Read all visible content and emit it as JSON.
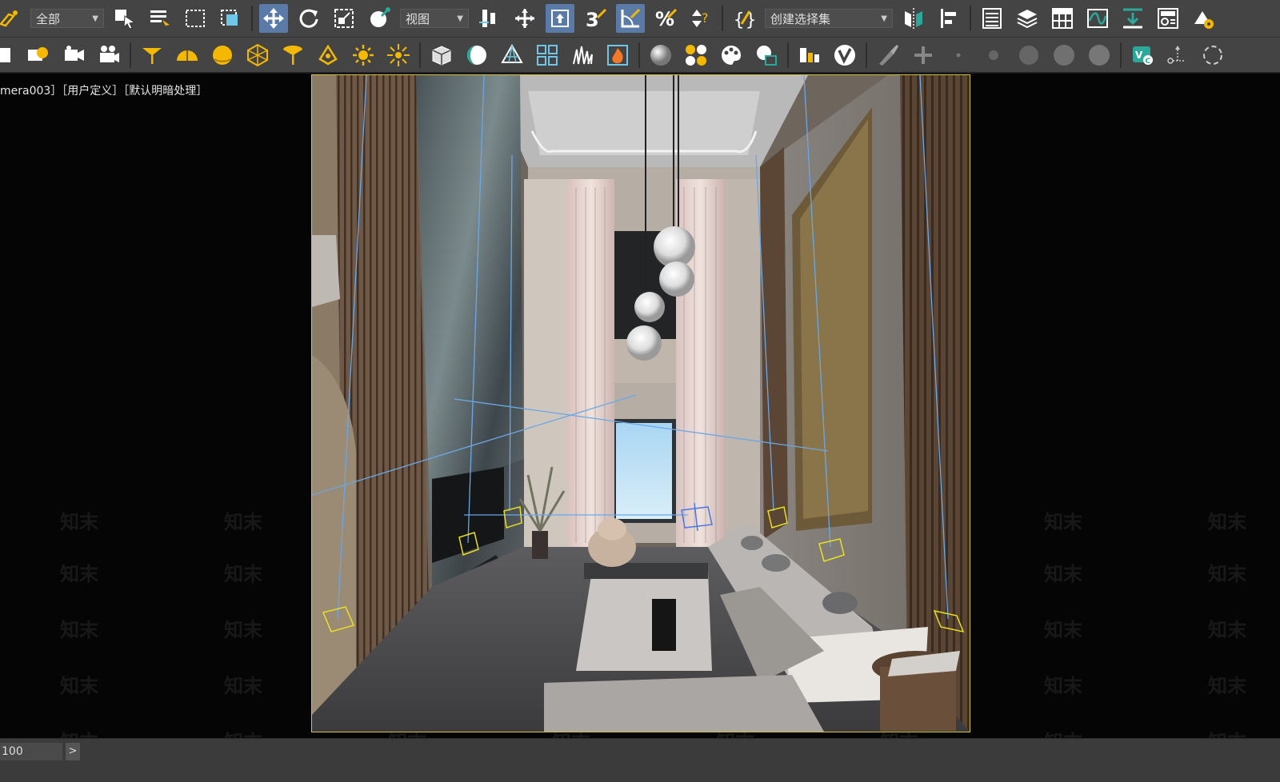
{
  "toolbar": {
    "selection_filter": "全部",
    "ref_coord_system": "视图",
    "named_selection_set": "创建选择集"
  },
  "viewport": {
    "label": "mera003］［用户定义］［默认明暗处理］",
    "watermark_text": "知末"
  },
  "timeline": {
    "frame_value": "100",
    "next_label": ">"
  },
  "colors": {
    "toolbar_bg": "#444444",
    "active_button": "#5a7aa8",
    "accent_yellow": "#f5b800",
    "safe_frame_border": "#d6c240",
    "light_gizmo": "#e8e020",
    "light_line": "#6aa8e8"
  },
  "icons": {
    "row1": [
      "link-icon",
      "select-object-icon",
      "select-by-name-icon",
      "rect-selection-icon",
      "window-crossing-icon",
      "select-move-icon",
      "select-rotate-icon",
      "select-scale-icon",
      "select-manipulate-icon",
      "mirror-icon",
      "align-icon",
      "snap-3d-icon",
      "angle-snap-icon",
      "percent-snap-icon",
      "spinner-snap-icon",
      "edit-named-selection-icon",
      "mirror-tool-icon",
      "align-tool-icon",
      "scene-explorer-icon",
      "layer-manager-icon",
      "ribbon-icon",
      "curve-editor-icon",
      "schematic-view-icon",
      "material-editor-icon",
      "render-setup-icon"
    ],
    "row2": [
      "render-frame-icon",
      "render-icon",
      "camera-icon",
      "target-spot-icon",
      "dome-light-icon",
      "sphere-light-icon",
      "geosphere-icon",
      "free-spot-icon",
      "omni-icon",
      "sun-icon",
      "skylight-icon",
      "box-icon",
      "teapot-icon",
      "pyramid-icon",
      "scatter-icon",
      "grass-icon",
      "fire-icon",
      "material-sphere-icon",
      "multi-material-icon",
      "palette-icon",
      "bake-icon",
      "asset-tracking-icon",
      "vray-icon",
      "brush-icon",
      "plus-icon",
      "dot-icon",
      "sphere-small-icon",
      "sphere-medium-icon",
      "sphere-large-icon",
      "vfb-icon",
      "gizmo-icon"
    ]
  }
}
